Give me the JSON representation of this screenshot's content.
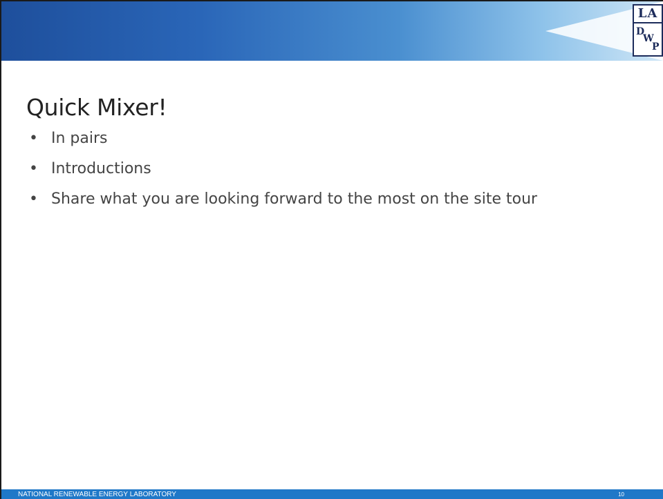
{
  "slide": {
    "title": "Quick Mixer!",
    "bullets": [
      "In pairs",
      "Introductions",
      "Share what you are looking forward to the most on the site tour"
    ],
    "bullet_glyph": "•"
  },
  "logo": {
    "icon": "ladwp-logo-icon",
    "top_text": "LA",
    "letters": [
      "D",
      "W",
      "P"
    ]
  },
  "footer": {
    "organization": "NATIONAL RENEWABLE ENERGY LABORATORY",
    "page_number": "10"
  },
  "colors": {
    "header_start": "#1e4f9c",
    "header_end": "#cfe6f6",
    "footer": "#1f78c8",
    "logo": "#1c2b5a"
  }
}
